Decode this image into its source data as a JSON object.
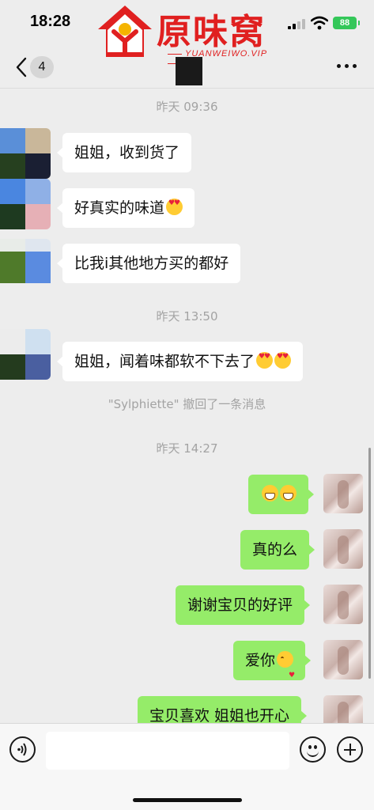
{
  "status_bar": {
    "time": "18:28",
    "battery": "88"
  },
  "watermark": {
    "title": "原味窝",
    "subtitle": "YUANWEIWO.VIP"
  },
  "nav": {
    "unread_count": "4"
  },
  "messages": {
    "ts1": "昨天 09:36",
    "m1": "姐姐，收到货了",
    "m2": "好真实的味道",
    "m3": "比我i其他地方买的都好",
    "ts2": "昨天 13:50",
    "m4": "姐姐，闻着味都软不下去了",
    "recall": "\"Sylphiette\" 撤回了一条消息",
    "ts3": "昨天 14:27",
    "m6": "真的么",
    "m7": "谢谢宝贝的好评",
    "m8": "爱你",
    "m9": "宝贝喜欢 姐姐也开心"
  },
  "emoji_names": [
    "heart-eyes-emoji",
    "grinning-emoji",
    "kiss-emoji"
  ],
  "colors": {
    "outgoing_bubble": "#95ec69",
    "incoming_bubble": "#ffffff",
    "background": "#ededed",
    "watermark": "#e02020"
  }
}
